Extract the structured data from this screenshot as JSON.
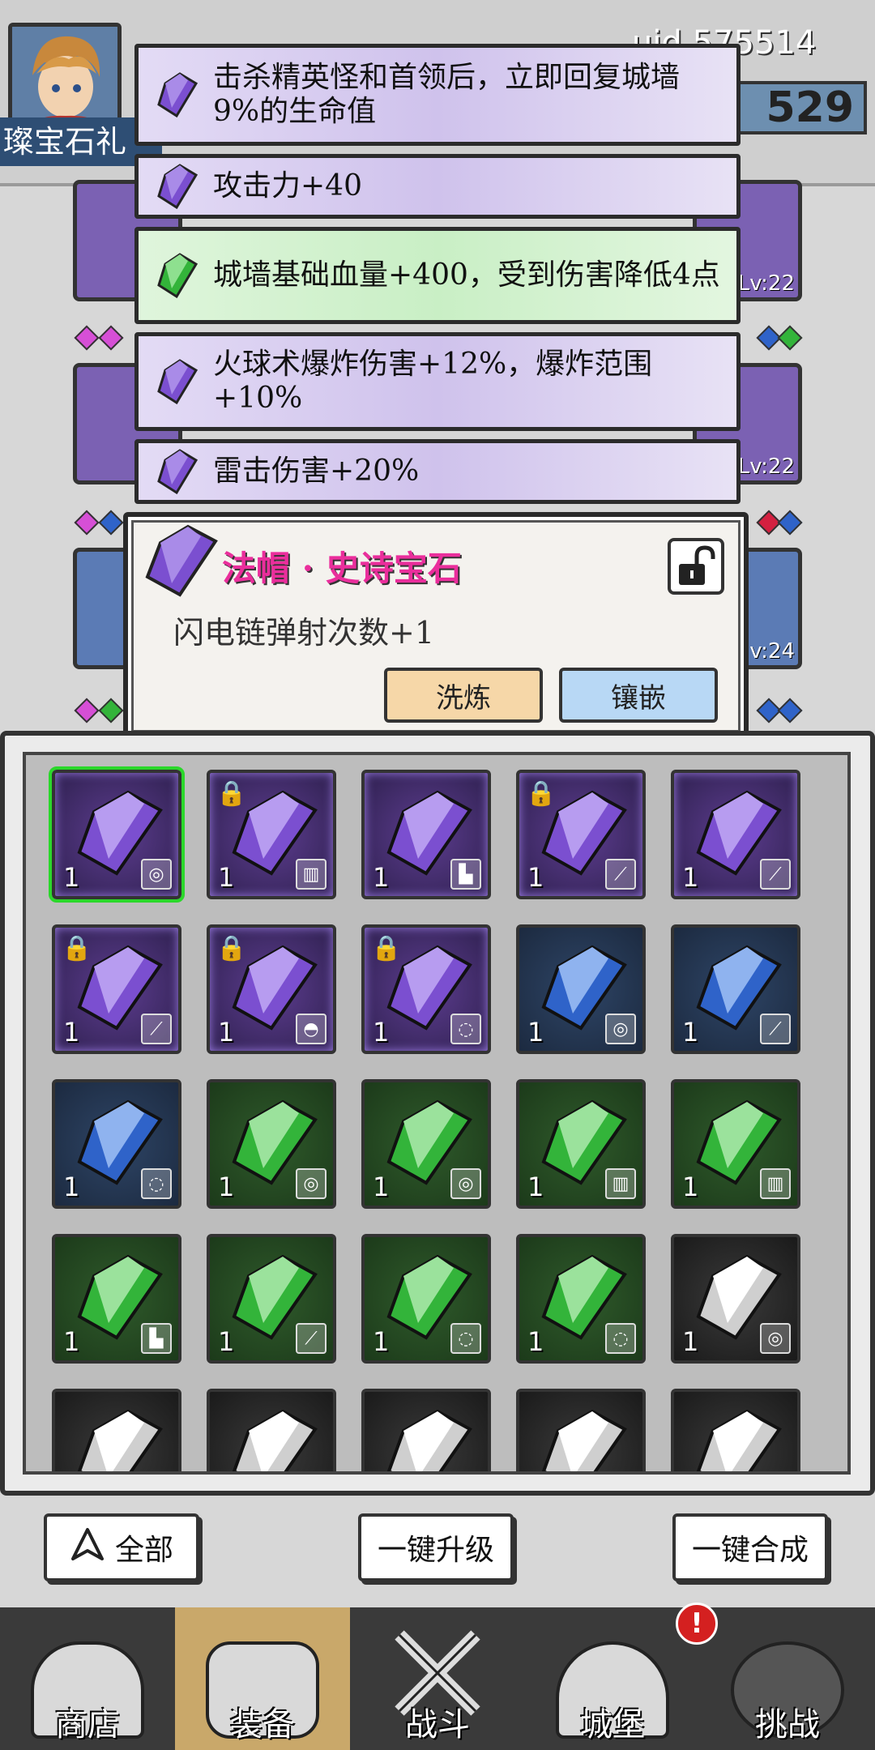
{
  "header": {
    "uid_text": "uid 575514",
    "coin_value": "529",
    "banner_text": "璨宝石礼"
  },
  "equip_slots": [
    {
      "level": "Lv:22"
    },
    {
      "level": "Lv:22"
    },
    {
      "level": "v:24"
    }
  ],
  "stats": [
    {
      "text": "击杀精英怪和首领后，立即回复城墙9%的生命值",
      "gem": "purple-gem-icon"
    },
    {
      "text": "攻击力+40",
      "gem": "purple-gem-icon"
    },
    {
      "text": "城墙基础血量+400，受到伤害降低4点",
      "gem": "green-gem-icon"
    },
    {
      "text": "火球术爆炸伤害+12%，爆炸范围+10%",
      "gem": "purple-gem-icon"
    },
    {
      "text": "雷击伤害+20%",
      "gem": "purple-gem-icon"
    }
  ],
  "popup": {
    "title": "法帽 · 史诗宝石",
    "description": "闪电链弹射次数+1",
    "refine_label": "洗炼",
    "inlay_label": "镶嵌"
  },
  "grid": [
    {
      "color": "purple",
      "count": "1",
      "equip": "ring",
      "locked": false,
      "selected": true
    },
    {
      "color": "purple",
      "count": "1",
      "equip": "armor",
      "locked": true
    },
    {
      "color": "purple",
      "count": "1",
      "equip": "boots",
      "locked": false
    },
    {
      "color": "purple",
      "count": "1",
      "equip": "staff",
      "locked": true
    },
    {
      "color": "purple",
      "count": "1",
      "equip": "staff",
      "locked": false
    },
    {
      "color": "purple",
      "count": "1",
      "equip": "staff",
      "locked": true
    },
    {
      "color": "purple",
      "count": "1",
      "equip": "hat",
      "locked": true
    },
    {
      "color": "purple",
      "count": "1",
      "equip": "necklace",
      "locked": true
    },
    {
      "color": "blue",
      "count": "1",
      "equip": "ring",
      "locked": false
    },
    {
      "color": "blue",
      "count": "1",
      "equip": "staff",
      "locked": false
    },
    {
      "color": "blue",
      "count": "1",
      "equip": "necklace",
      "locked": false
    },
    {
      "color": "green",
      "count": "1",
      "equip": "ring",
      "locked": false
    },
    {
      "color": "green",
      "count": "1",
      "equip": "ring",
      "locked": false
    },
    {
      "color": "green",
      "count": "1",
      "equip": "armor",
      "locked": false
    },
    {
      "color": "green",
      "count": "1",
      "equip": "armor",
      "locked": false
    },
    {
      "color": "green",
      "count": "1",
      "equip": "boots",
      "locked": false
    },
    {
      "color": "green",
      "count": "1",
      "equip": "staff",
      "locked": false
    },
    {
      "color": "green",
      "count": "1",
      "equip": "necklace",
      "locked": false
    },
    {
      "color": "green",
      "count": "1",
      "equip": "necklace",
      "locked": false
    },
    {
      "color": "gray",
      "count": "1",
      "equip": "ring",
      "locked": false
    },
    {
      "color": "gray",
      "count": "",
      "equip": "",
      "locked": false
    },
    {
      "color": "gray",
      "count": "",
      "equip": "",
      "locked": false
    },
    {
      "color": "gray",
      "count": "",
      "equip": "",
      "locked": false
    },
    {
      "color": "gray",
      "count": "",
      "equip": "",
      "locked": false
    },
    {
      "color": "gray",
      "count": "",
      "equip": "",
      "locked": false
    }
  ],
  "actions": {
    "all_label": "全部",
    "upgrade_label": "一键升级",
    "combine_label": "一键合成"
  },
  "nav": [
    {
      "label": "商店",
      "icon": "shop-icon"
    },
    {
      "label": "装备",
      "icon": "backpack-icon",
      "active": true
    },
    {
      "label": "战斗",
      "icon": "crossed-swords-icon"
    },
    {
      "label": "城堡",
      "icon": "castle-icon"
    },
    {
      "label": "挑战",
      "icon": "locked-challenge-icon"
    }
  ],
  "notification_badge": "!",
  "colors": {
    "purple_gem": "#7b4fd0",
    "blue_gem": "#2f63c9",
    "green_gem": "#33b43a",
    "gray_gem": "#d0d0d0",
    "title_pink": "#ea2e9c"
  }
}
